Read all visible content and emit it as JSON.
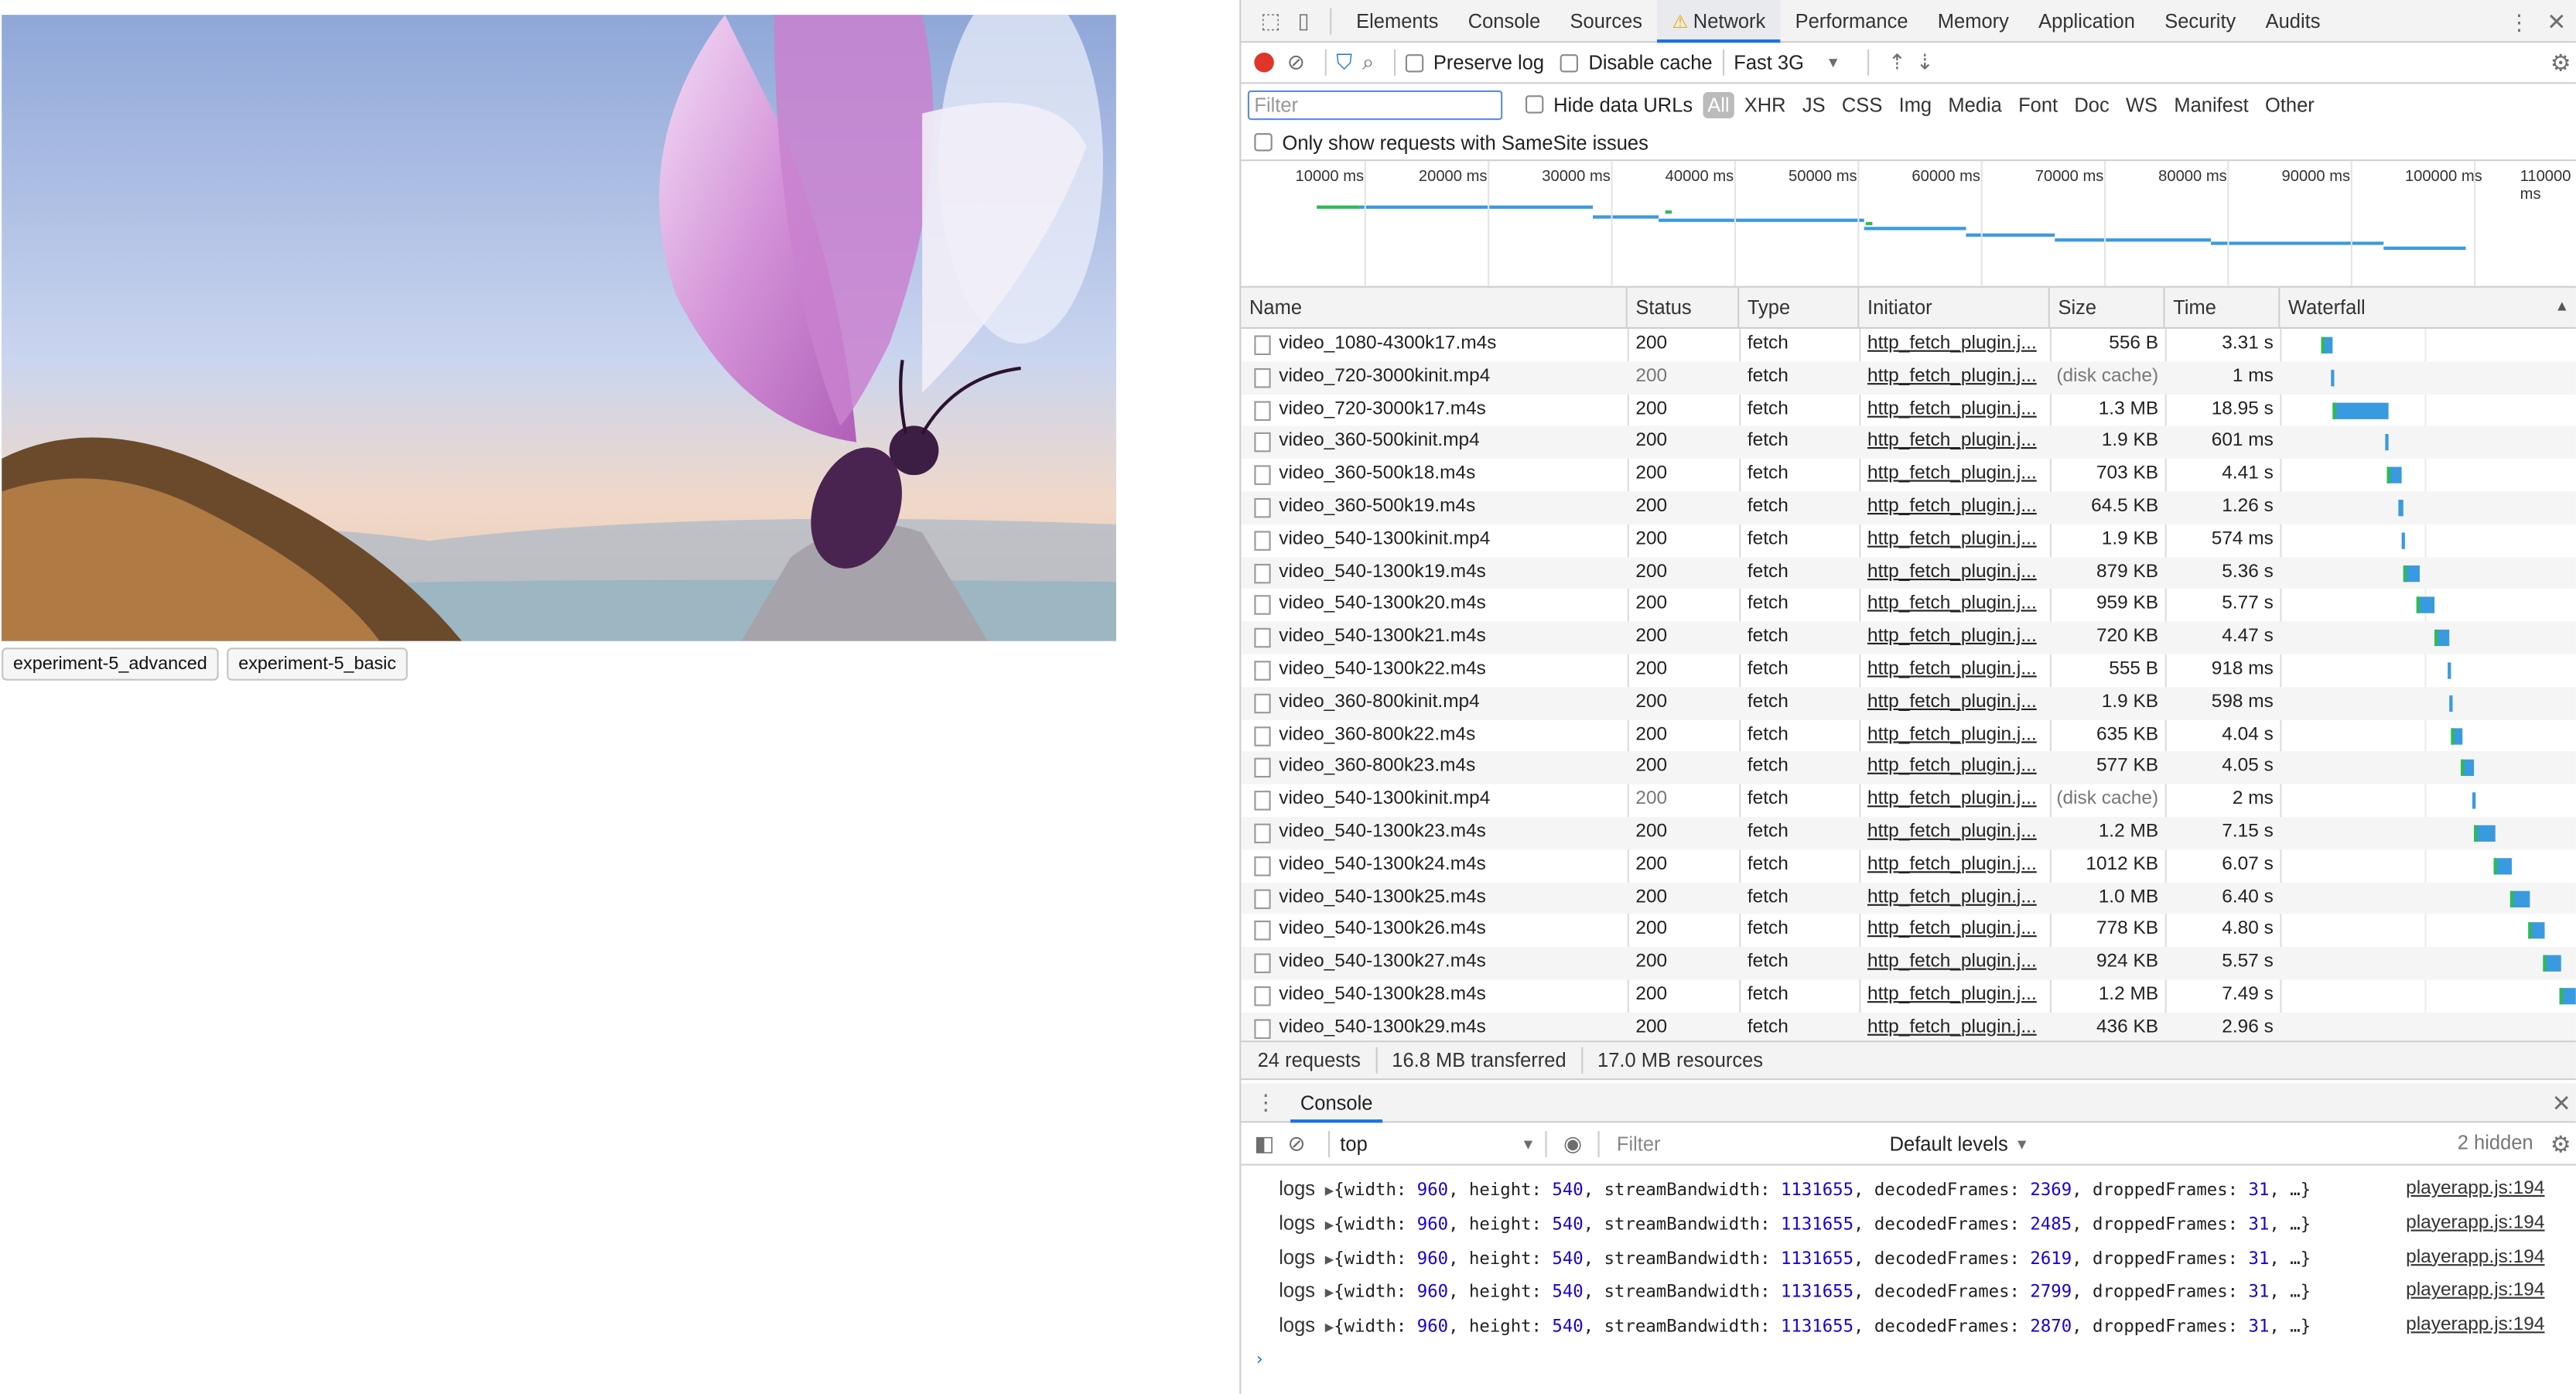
{
  "page": {
    "buttons": [
      "experiment-5_advanced",
      "experiment-5_basic"
    ]
  },
  "devtools": {
    "tabs": [
      "Elements",
      "Console",
      "Sources",
      "Network",
      "Performance",
      "Memory",
      "Application",
      "Security",
      "Audits"
    ],
    "active_tab": "Network",
    "toolbar": {
      "preserve_log": "Preserve log",
      "disable_cache": "Disable cache",
      "throttle": "Fast 3G"
    },
    "filter": {
      "placeholder": "Filter",
      "hide_data_urls": "Hide data URLs",
      "types": [
        "All",
        "XHR",
        "JS",
        "CSS",
        "Img",
        "Media",
        "Font",
        "Doc",
        "WS",
        "Manifest",
        "Other"
      ],
      "samesite": "Only show requests with SameSite issues"
    },
    "timeline_ticks": [
      "10000 ms",
      "20000 ms",
      "30000 ms",
      "40000 ms",
      "50000 ms",
      "60000 ms",
      "70000 ms",
      "80000 ms",
      "90000 ms",
      "100000 ms",
      "110000 ms"
    ],
    "columns": [
      "Name",
      "Status",
      "Type",
      "Initiator",
      "Size",
      "Time",
      "Waterfall"
    ],
    "rows": [
      {
        "name": "video_1080-4300k17.m4s",
        "status": "200",
        "type": "fetch",
        "initiator": "http_fetch_plugin.j...",
        "size": "556 B",
        "time": "3.31 s",
        "ws": 1411,
        "we": 1418
      },
      {
        "name": "video_720-3000kinit.mp4",
        "status": "200",
        "type": "fetch",
        "initiator": "http_fetch_plugin.j...",
        "size": "(disk cache)",
        "time": "1 ms",
        "ws": 1417,
        "we": 1419
      },
      {
        "name": "video_720-3000k17.m4s",
        "status": "200",
        "type": "fetch",
        "initiator": "http_fetch_plugin.j...",
        "size": "1.3 MB",
        "time": "18.95 s",
        "ws": 1418,
        "we": 1452
      },
      {
        "name": "video_360-500kinit.mp4",
        "status": "200",
        "type": "fetch",
        "initiator": "http_fetch_plugin.j...",
        "size": "1.9 KB",
        "time": "601 ms",
        "ws": 1450,
        "we": 1452
      },
      {
        "name": "video_360-500k18.m4s",
        "status": "200",
        "type": "fetch",
        "initiator": "http_fetch_plugin.j...",
        "size": "703 KB",
        "time": "4.41 s",
        "ws": 1451,
        "we": 1460
      },
      {
        "name": "video_360-500k19.m4s",
        "status": "200",
        "type": "fetch",
        "initiator": "http_fetch_plugin.j...",
        "size": "64.5 KB",
        "time": "1.26 s",
        "ws": 1458,
        "we": 1461
      },
      {
        "name": "video_540-1300kinit.mp4",
        "status": "200",
        "type": "fetch",
        "initiator": "http_fetch_plugin.j...",
        "size": "1.9 KB",
        "time": "574 ms",
        "ws": 1460,
        "we": 1462
      },
      {
        "name": "video_540-1300k19.m4s",
        "status": "200",
        "type": "fetch",
        "initiator": "http_fetch_plugin.j...",
        "size": "879 KB",
        "time": "5.36 s",
        "ws": 1461,
        "we": 1471
      },
      {
        "name": "video_540-1300k20.m4s",
        "status": "200",
        "type": "fetch",
        "initiator": "http_fetch_plugin.j...",
        "size": "959 KB",
        "time": "5.77 s",
        "ws": 1469,
        "we": 1480
      },
      {
        "name": "video_540-1300k21.m4s",
        "status": "200",
        "type": "fetch",
        "initiator": "http_fetch_plugin.j...",
        "size": "720 KB",
        "time": "4.47 s",
        "ws": 1480,
        "we": 1489
      },
      {
        "name": "video_540-1300k22.m4s",
        "status": "200",
        "type": "fetch",
        "initiator": "http_fetch_plugin.j...",
        "size": "555 B",
        "time": "918 ms",
        "ws": 1488,
        "we": 1490
      },
      {
        "name": "video_360-800kinit.mp4",
        "status": "200",
        "type": "fetch",
        "initiator": "http_fetch_plugin.j...",
        "size": "1.9 KB",
        "time": "598 ms",
        "ws": 1489,
        "we": 1491
      },
      {
        "name": "video_360-800k22.m4s",
        "status": "200",
        "type": "fetch",
        "initiator": "http_fetch_plugin.j...",
        "size": "635 KB",
        "time": "4.04 s",
        "ws": 1490,
        "we": 1497
      },
      {
        "name": "video_360-800k23.m4s",
        "status": "200",
        "type": "fetch",
        "initiator": "http_fetch_plugin.j...",
        "size": "577 KB",
        "time": "4.05 s",
        "ws": 1496,
        "we": 1504
      },
      {
        "name": "video_540-1300kinit.mp4",
        "status": "200",
        "type": "fetch",
        "initiator": "http_fetch_plugin.j...",
        "size": "(disk cache)",
        "time": "2 ms",
        "ws": 1503,
        "we": 1505
      },
      {
        "name": "video_540-1300k23.m4s",
        "status": "200",
        "type": "fetch",
        "initiator": "http_fetch_plugin.j...",
        "size": "1.2 MB",
        "time": "7.15 s",
        "ws": 1504,
        "we": 1517
      },
      {
        "name": "video_540-1300k24.m4s",
        "status": "200",
        "type": "fetch",
        "initiator": "http_fetch_plugin.j...",
        "size": "1012 KB",
        "time": "6.07 s",
        "ws": 1516,
        "we": 1527
      },
      {
        "name": "video_540-1300k25.m4s",
        "status": "200",
        "type": "fetch",
        "initiator": "http_fetch_plugin.j...",
        "size": "1.0 MB",
        "time": "6.40 s",
        "ws": 1526,
        "we": 1538
      },
      {
        "name": "video_540-1300k26.m4s",
        "status": "200",
        "type": "fetch",
        "initiator": "http_fetch_plugin.j...",
        "size": "778 KB",
        "time": "4.80 s",
        "ws": 1537,
        "we": 1547
      },
      {
        "name": "video_540-1300k27.m4s",
        "status": "200",
        "type": "fetch",
        "initiator": "http_fetch_plugin.j...",
        "size": "924 KB",
        "time": "5.57 s",
        "ws": 1546,
        "we": 1557
      },
      {
        "name": "video_540-1300k28.m4s",
        "status": "200",
        "type": "fetch",
        "initiator": "http_fetch_plugin.j...",
        "size": "1.2 MB",
        "time": "7.49 s",
        "ws": 1556,
        "we": 1568
      },
      {
        "name": "video_540-1300k29.m4s",
        "status": "200",
        "type": "fetch",
        "initiator": "http_fetch_plugin.j...",
        "size": "436 KB",
        "time": "2.96 s",
        "ws": 1567,
        "we": 1570
      }
    ],
    "summary": [
      "24 requests",
      "16.8 MB transferred",
      "17.0 MB resources"
    ],
    "drawer": {
      "tab": "Console",
      "context": "top",
      "filter_placeholder": "Filter",
      "levels": "Default levels",
      "hidden": "2 hidden"
    },
    "logs": [
      {
        "key": "logs",
        "w": "960",
        "h": "540",
        "bw": "1131655",
        "df": "2369",
        "dr": "31",
        "src": "playerapp.js:194"
      },
      {
        "key": "logs",
        "w": "960",
        "h": "540",
        "bw": "1131655",
        "df": "2485",
        "dr": "31",
        "src": "playerapp.js:194"
      },
      {
        "key": "logs",
        "w": "960",
        "h": "540",
        "bw": "1131655",
        "df": "2619",
        "dr": "31",
        "src": "playerapp.js:194"
      },
      {
        "key": "logs",
        "w": "960",
        "h": "540",
        "bw": "1131655",
        "df": "2799",
        "dr": "31",
        "src": "playerapp.js:194"
      },
      {
        "key": "logs",
        "w": "960",
        "h": "540",
        "bw": "1131655",
        "df": "2870",
        "dr": "31",
        "src": "playerapp.js:194"
      }
    ]
  }
}
